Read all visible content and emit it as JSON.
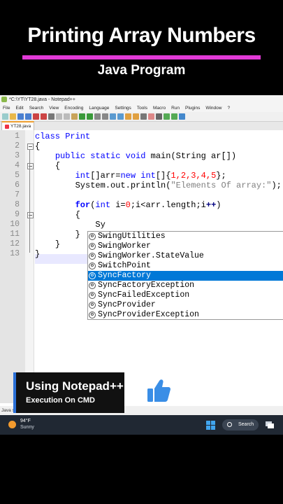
{
  "video": {
    "title": "Printing Array Numbers",
    "subtitle": "Java Program",
    "badge_line1": "Using Notepad++",
    "badge_line2": "Execution On CMD"
  },
  "window": {
    "title": "*C:\\YT\\YT28.java - Notepad++",
    "menu": [
      "File",
      "Edit",
      "Search",
      "View",
      "Encoding",
      "Language",
      "Settings",
      "Tools",
      "Macro",
      "Run",
      "Plugins",
      "Window",
      "?"
    ],
    "tab": "YT28.java",
    "status_text": "Java s"
  },
  "editor": {
    "line_numbers": [
      "1",
      "2",
      "3",
      "4",
      "5",
      "6",
      "7",
      "8",
      "9",
      "10",
      "11",
      "12",
      "13"
    ],
    "lines": {
      "l1": "class Print",
      "l2": "{",
      "l3_kw": "public static void",
      "l3_rest": " main(String ar[])",
      "l4": "{",
      "l5_a": "int",
      "l5_b": "[]arr=",
      "l5_c": "new int",
      "l5_d": "[]{",
      "l5_nums": "1,2,3,4,5",
      "l5_e": "};",
      "l6_a": "System.out.println(",
      "l6_str": "\"Elements Of array:\"",
      "l6_b": ");",
      "l8_kw1": "for",
      "l8_b": "(",
      "l8_kw2": "int",
      "l8_c": " i=",
      "l8_n": "0",
      "l8_d": ";i<arr.length;i",
      "l8_op": "++",
      "l8_e": ")",
      "l9": "{",
      "l10": "Sy",
      "l11": "}",
      "l12": "}",
      "l13": "}"
    }
  },
  "autocomplete": {
    "items": [
      "SwingUtilities",
      "SwingWorker",
      "SwingWorker.StateValue",
      "SwitchPoint",
      "SyncFactory",
      "SyncFactoryException",
      "SyncFailedException",
      "SyncProvider",
      "SyncProviderException"
    ],
    "selected_index": 4
  },
  "taskbar": {
    "temperature": "94°F",
    "condition": "Sunny",
    "search_label": "Search"
  },
  "colors": {
    "accent_bar": "#e23ad7",
    "keyword": "#0000ff",
    "number": "#ff0000",
    "string": "#808080",
    "selection": "#0078d7",
    "thumb": "#3a8ee6"
  }
}
